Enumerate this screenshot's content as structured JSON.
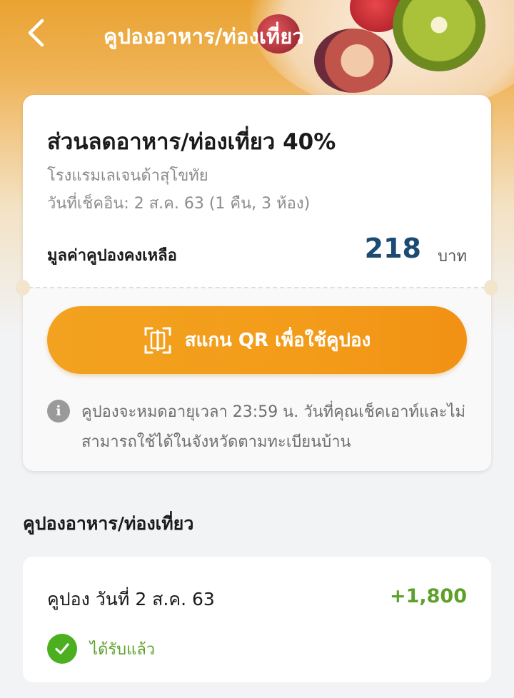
{
  "header": {
    "title": "คูปองอาหาร/ท่องเที่ยว",
    "back_icon": "chevron-left-icon"
  },
  "coupon": {
    "title": "ส่วนลดอาหาร/ท่องเที่ยว 40%",
    "hotel": "โรงแรมเลเจนด้าสุโขทัย",
    "checkin": "วันที่เช็คอิน: 2 ส.ค. 63 (1 คืน, 3 ห้อง)",
    "balance_label": "มูลค่าคูปองคงเหลือ",
    "balance_value": "218",
    "balance_unit": "บาท",
    "balance_color": "#1b4a73"
  },
  "scan_button": {
    "label": "สแกน QR เพื่อใช้คูปอง",
    "icon": "qr-scan-icon",
    "color": "#f39c1a"
  },
  "notice": {
    "icon": "info-icon",
    "text": "คูปองจะหมดอายุเวลา 23:59 น. วันที่คุณเช็คเอาท์และไม่สามารถใช้ได้ในจังหวัดตามทะเบียนบ้าน"
  },
  "history": {
    "section_title": "คูปองอาหาร/ท่องเที่ยว",
    "items": [
      {
        "label": "คูปอง วันที่ 2 ส.ค. 63",
        "amount": "+1,800",
        "status": "ได้รับแล้ว",
        "status_icon": "check-circle-icon",
        "status_color": "#4caf1f"
      }
    ]
  }
}
